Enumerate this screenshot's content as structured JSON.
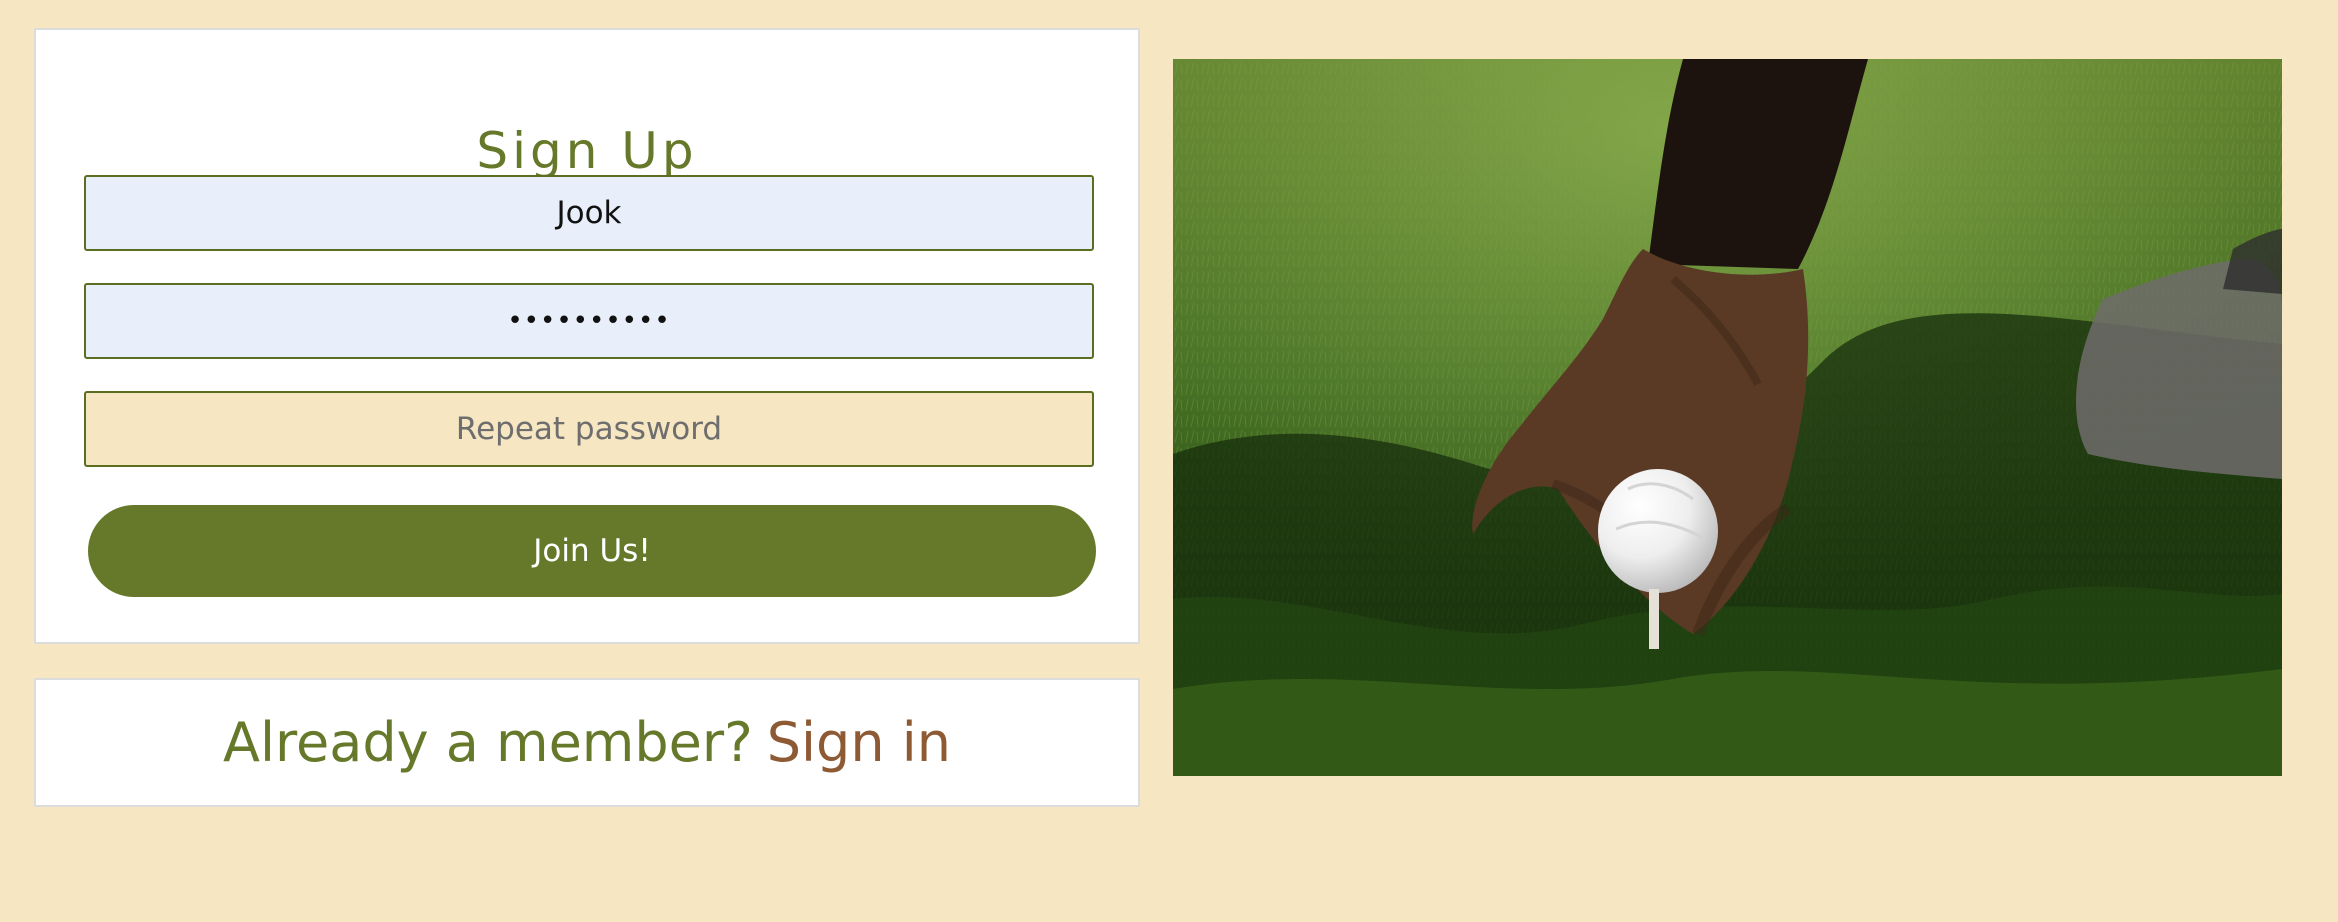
{
  "signup": {
    "title": "Sign Up",
    "username_value": "Jook",
    "password_value": "••••••••••",
    "repeat_password_placeholder": "Repeat password",
    "join_button_label": "Join Us!"
  },
  "member_prompt": {
    "text": "Already a member?",
    "signin_link_label": "Sign in"
  },
  "colors": {
    "background": "#f6e6c1",
    "accent_green": "#66792a",
    "link_brown": "#8d5a34",
    "filled_input": "#e8effb"
  },
  "hero": {
    "icon": "golf-ball-image"
  }
}
